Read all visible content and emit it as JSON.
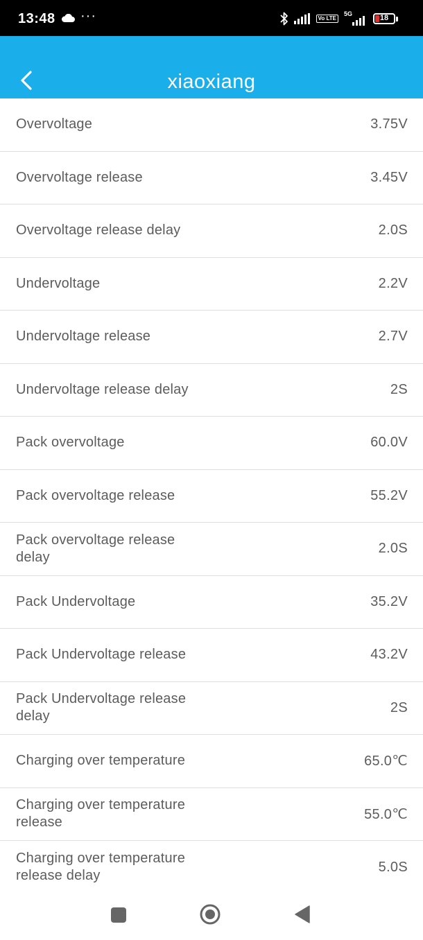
{
  "status_bar": {
    "time": "13:48",
    "more_indicator": "···",
    "network_5g": "5G",
    "volte_label": "Vo LTE",
    "battery_level": "18",
    "icons": [
      "cloud-icon",
      "bluetooth-icon",
      "signal-icon",
      "volte-icon",
      "5g-signal-icon",
      "battery-icon"
    ],
    "battery_color": "#e0302f"
  },
  "app_bar": {
    "title": "xiaoxiang",
    "background_color": "#1aaeea",
    "back_icon": "chevron-left-icon"
  },
  "settings": [
    {
      "label": "Overvoltage",
      "value": "3.75V"
    },
    {
      "label": "Overvoltage release",
      "value": "3.45V"
    },
    {
      "label": "Overvoltage release delay",
      "value": "2.0S"
    },
    {
      "label": "Undervoltage",
      "value": "2.2V"
    },
    {
      "label": "Undervoltage release",
      "value": "2.7V"
    },
    {
      "label": "Undervoltage release delay",
      "value": "2S"
    },
    {
      "label": "Pack overvoltage",
      "value": "60.0V"
    },
    {
      "label": "Pack overvoltage release",
      "value": "55.2V"
    },
    {
      "label": "Pack overvoltage release delay",
      "value": "2.0S"
    },
    {
      "label": "Pack Undervoltage",
      "value": "35.2V"
    },
    {
      "label": "Pack Undervoltage release",
      "value": "43.2V"
    },
    {
      "label": "Pack Undervoltage release delay",
      "value": "2S"
    },
    {
      "label": "Charging over temperature",
      "value": "65.0℃"
    },
    {
      "label": "Charging over temperature release",
      "value": "55.0℃"
    },
    {
      "label": "Charging over temperature release delay",
      "value": "5.0S"
    }
  ],
  "nav_bar": {
    "icons": [
      "recents-square-icon",
      "home-circle-icon",
      "back-triangle-icon"
    ]
  }
}
